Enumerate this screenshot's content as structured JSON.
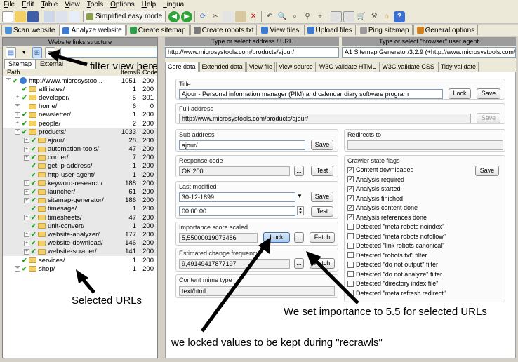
{
  "menu": [
    "File",
    "Edit",
    "Table",
    "View",
    "Tools",
    "Options",
    "Help",
    "Lingua"
  ],
  "toolbar": {
    "mode_label": "Simplified easy mode"
  },
  "main_tabs": [
    {
      "label": "Scan website"
    },
    {
      "label": "Analyze website"
    },
    {
      "label": "Create sitemap"
    },
    {
      "label": "Create robots.txt"
    },
    {
      "label": "View files"
    },
    {
      "label": "Upload files"
    },
    {
      "label": "Ping sitemap"
    },
    {
      "label": "General options"
    }
  ],
  "left": {
    "header": "Website links structure",
    "subtabs": [
      "Sitemap",
      "External"
    ],
    "columns": {
      "path": "Path",
      "items": "Items",
      "code": "R.Code"
    },
    "rows": [
      {
        "name": "http://www.microsystoo...",
        "items": "1051",
        "code": "200",
        "level": 0,
        "exp": "-",
        "check": true,
        "icon": "globe",
        "sel": false
      },
      {
        "name": "affiliates/",
        "items": "1",
        "code": "200",
        "level": 1,
        "exp": "",
        "check": true,
        "icon": "folder",
        "sel": false
      },
      {
        "name": "developer/",
        "items": "5",
        "code": "301",
        "level": 1,
        "exp": "+",
        "check": true,
        "icon": "folder",
        "sel": false
      },
      {
        "name": "home/",
        "items": "6",
        "code": "0",
        "level": 1,
        "exp": "+",
        "check": false,
        "icon": "folder",
        "sel": false
      },
      {
        "name": "newsletter/",
        "items": "1",
        "code": "200",
        "level": 1,
        "exp": "+",
        "check": true,
        "icon": "folder",
        "sel": false
      },
      {
        "name": "people/",
        "items": "2",
        "code": "200",
        "level": 1,
        "exp": "+",
        "check": true,
        "icon": "folder",
        "sel": false
      },
      {
        "name": "products/",
        "items": "1033",
        "code": "200",
        "level": 1,
        "exp": "-",
        "check": true,
        "icon": "folder",
        "sel": true
      },
      {
        "name": "ajour/",
        "items": "28",
        "code": "200",
        "level": 2,
        "exp": "+",
        "check": true,
        "icon": "folder",
        "sel": true
      },
      {
        "name": "automation-tools/",
        "items": "47",
        "code": "200",
        "level": 2,
        "exp": "+",
        "check": true,
        "icon": "folder",
        "sel": true
      },
      {
        "name": "corner/",
        "items": "7",
        "code": "200",
        "level": 2,
        "exp": "+",
        "check": true,
        "icon": "folder",
        "sel": true
      },
      {
        "name": "get-ip-address/",
        "items": "1",
        "code": "200",
        "level": 2,
        "exp": "",
        "check": true,
        "icon": "folder",
        "sel": true
      },
      {
        "name": "http-user-agent/",
        "items": "1",
        "code": "200",
        "level": 2,
        "exp": "",
        "check": true,
        "icon": "folder",
        "sel": true
      },
      {
        "name": "keyword-research/",
        "items": "188",
        "code": "200",
        "level": 2,
        "exp": "+",
        "check": true,
        "icon": "folder",
        "sel": true
      },
      {
        "name": "launcher/",
        "items": "61",
        "code": "200",
        "level": 2,
        "exp": "+",
        "check": true,
        "icon": "folder",
        "sel": true
      },
      {
        "name": "sitemap-generator/",
        "items": "186",
        "code": "200",
        "level": 2,
        "exp": "+",
        "check": true,
        "icon": "folder",
        "sel": true
      },
      {
        "name": "timesage/",
        "items": "1",
        "code": "200",
        "level": 2,
        "exp": "",
        "check": true,
        "icon": "folder",
        "sel": true
      },
      {
        "name": "timesheets/",
        "items": "47",
        "code": "200",
        "level": 2,
        "exp": "+",
        "check": true,
        "icon": "folder",
        "sel": true
      },
      {
        "name": "unit-convert/",
        "items": "1",
        "code": "200",
        "level": 2,
        "exp": "",
        "check": true,
        "icon": "folder",
        "sel": true
      },
      {
        "name": "website-analyzer/",
        "items": "177",
        "code": "200",
        "level": 2,
        "exp": "+",
        "check": true,
        "icon": "folder",
        "sel": true
      },
      {
        "name": "website-download/",
        "items": "146",
        "code": "200",
        "level": 2,
        "exp": "+",
        "check": true,
        "icon": "folder",
        "sel": true
      },
      {
        "name": "website-scraper/",
        "items": "141",
        "code": "200",
        "level": 2,
        "exp": "+",
        "check": true,
        "icon": "folder",
        "sel": true
      },
      {
        "name": "services/",
        "items": "1",
        "code": "200",
        "level": 1,
        "exp": "",
        "check": true,
        "icon": "folder",
        "sel": false
      },
      {
        "name": "shop/",
        "items": "1",
        "code": "200",
        "level": 1,
        "exp": "+",
        "check": true,
        "icon": "folder",
        "sel": false
      }
    ]
  },
  "address": {
    "url_header": "Type or select address / URL",
    "url_value": "http://www.microsystools.com/products/ajour/",
    "agent_header": "Type or select \"browser\" user agent",
    "agent_value": "A1 Sitemap Generator/3.2.9 (+http://www.microsystools.com/pro"
  },
  "right_tabs": [
    "Core data",
    "Extended data",
    "View file",
    "View source",
    "W3C validate HTML",
    "W3C validate CSS",
    "Tidy validate"
  ],
  "core": {
    "title_label": "Title",
    "title_value": "Ajour - Personal information manager (PIM) and calendar diary software program",
    "full_label": "Full address",
    "full_value": "http://www.microsystools.com/products/ajour/",
    "sub_label": "Sub address",
    "sub_value": "ajour/",
    "redirects_label": "Redirects to",
    "resp_label": "Response code",
    "resp_value": "OK 200",
    "lastmod_label": "Last modified",
    "date_value": "30-12-1899",
    "time_value": "00:00:00",
    "imp_label": "Importance score scaled",
    "imp_value": "5,55000019073486",
    "freq_label": "Estimated change frequency",
    "freq_value": "9,49149417877197",
    "mime_label": "Content mime type",
    "mime_value": "text/html",
    "crawler_label": "Crawler state flags",
    "btn_lock": "Lock",
    "btn_save": "Save",
    "btn_test": "Test",
    "btn_fetch": "Fetch",
    "btn_dots": "...",
    "flags": [
      {
        "label": "Content downloaded",
        "on": true
      },
      {
        "label": "Analysis required",
        "on": true
      },
      {
        "label": "Analysis started",
        "on": true
      },
      {
        "label": "Analysis finished",
        "on": true
      },
      {
        "label": "Analysis content done",
        "on": true
      },
      {
        "label": "Analysis references done",
        "on": true
      },
      {
        "label": "Detected \"meta robots noindex\"",
        "on": false
      },
      {
        "label": "Detected \"meta robots nofollow\"",
        "on": false
      },
      {
        "label": "Detected \"link robots canonical\"",
        "on": false
      },
      {
        "label": "Detected \"robots.txt\" filter",
        "on": false
      },
      {
        "label": "Detected \"do not output\" filter",
        "on": false
      },
      {
        "label": "Detected \"do not analyze\" filter",
        "on": false
      },
      {
        "label": "Detected \"directory index file\"",
        "on": false
      },
      {
        "label": "Detected \"meta refresh redirect\"",
        "on": false
      }
    ]
  },
  "annotations": {
    "filter": "filter view here",
    "selected": "Selected URLs",
    "importance": "We set importance to 5.5 for selected URLs",
    "locked": "we locked values to be kept during \"recrawls\""
  }
}
